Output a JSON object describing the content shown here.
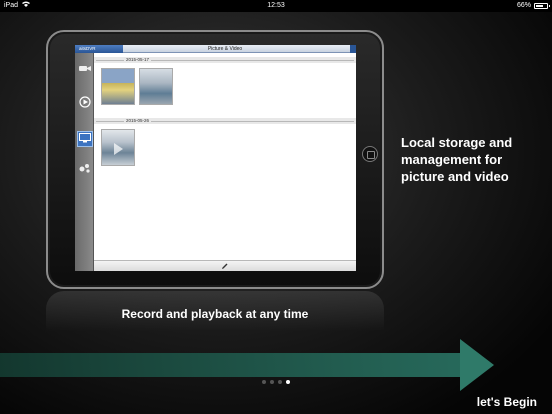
{
  "status_bar": {
    "device": "iPad",
    "time": "12:53",
    "battery": "66%",
    "battery_level": 0.66
  },
  "app": {
    "tab_label": "aitsDVR",
    "title": "Picture & Video"
  },
  "sidebar": {
    "items": [
      {
        "icon": "camera-icon",
        "active": false
      },
      {
        "icon": "play-icon",
        "active": false
      },
      {
        "icon": "monitor-icon",
        "active": true
      },
      {
        "icon": "settings-icon",
        "active": false
      }
    ]
  },
  "gallery": {
    "groups": [
      {
        "date": "2015-05-17",
        "items": [
          {
            "type": "picture"
          },
          {
            "type": "picture"
          }
        ]
      },
      {
        "date": "2015-05-26",
        "items": [
          {
            "type": "video"
          }
        ]
      }
    ]
  },
  "bottom_bar": {
    "icon": "edit-icon"
  },
  "captions": {
    "right": "Local storage and management for picture and video",
    "bottom": "Record and playback at any time"
  },
  "pager": {
    "count": 4,
    "current": 4
  },
  "begin_label": "let's Begin",
  "colors": {
    "arrow": "#2f7a69",
    "sidebar_active": "#3c73c0",
    "app_tab": "#2a5696"
  }
}
